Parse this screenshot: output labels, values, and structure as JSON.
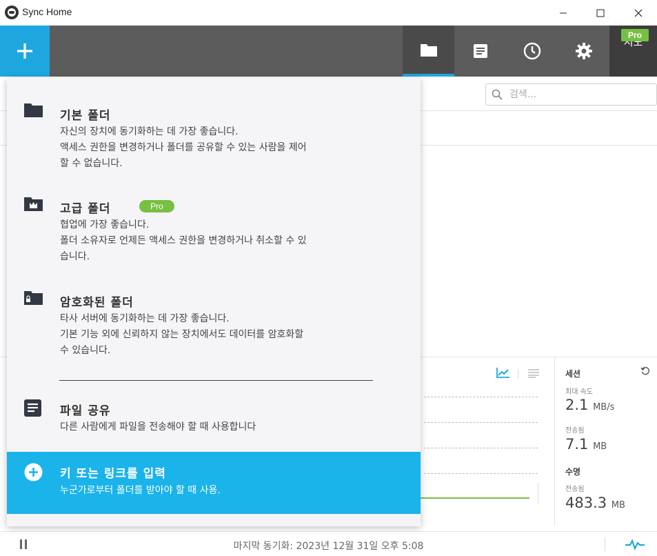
{
  "window": {
    "title": "Sync Home",
    "logo_icon": "sync-logo-icon"
  },
  "toolbar": {
    "add_icon": "plus-icon",
    "items": [
      {
        "name": "folders",
        "icon": "folder-icon",
        "active": true
      },
      {
        "name": "files",
        "icon": "document-icon",
        "active": false
      },
      {
        "name": "history",
        "icon": "clock-icon",
        "active": false
      },
      {
        "name": "settings",
        "icon": "gear-icon",
        "active": false
      }
    ],
    "trial_label": "시도",
    "pro_label": "Pro",
    "accent_color": "#1ea7df"
  },
  "search": {
    "placeholder": "검색..."
  },
  "menu": {
    "items": [
      {
        "icon": "folder-icon",
        "title": "기본 폴더",
        "desc": [
          "자신의 장치에 동기화하는 데 가장 좋습니다.",
          "액세스 권한을 변경하거나 폴더를 공유할 수 있는 사람을 제어",
          "할 수 없습니다."
        ]
      },
      {
        "icon": "crown-folder-icon",
        "title": "고급 폴더",
        "badge": "Pro",
        "desc": [
          "협업에 가장 좋습니다.",
          "폴더 소유자로 언제든 액세스 권한을 변경하거나 취소할 수 있",
          "습니다."
        ]
      },
      {
        "icon": "lock-folder-icon",
        "title": "암호화된 폴더",
        "desc": [
          "타사 서버에 동기화하는 데 가장 좋습니다.",
          "기본 기능 외에 신뢰하지 않는 장치에서도 데이터를 암호화할",
          "수 있습니다."
        ]
      },
      {
        "icon": "file-share-icon",
        "title": "파일 공유",
        "desc": [
          "다른 사람에게 파일을 전송해야 할 때 사용합니다"
        ]
      },
      {
        "icon": "plus-circle-icon",
        "title": "키 또는 링크를 입력",
        "desc": [
          "누군가로부터 폴더를 받아야 할 때 사용."
        ],
        "highlighted": true
      }
    ]
  },
  "stats": {
    "session_label": "세션",
    "max_speed_label": "최대 속도",
    "max_speed_value": "2.1",
    "max_speed_unit": "MB/s",
    "transferred_label": "전송됨",
    "transferred_value": "7.1",
    "transferred_unit": "MB",
    "lifetime_label": "수명",
    "lifetime_transferred_label": "전송됨",
    "lifetime_value": "483.3",
    "lifetime_unit": "MB"
  },
  "status": {
    "last_sync": "마지막 동기화: 2023년 12월 31일 오후 5:08"
  }
}
